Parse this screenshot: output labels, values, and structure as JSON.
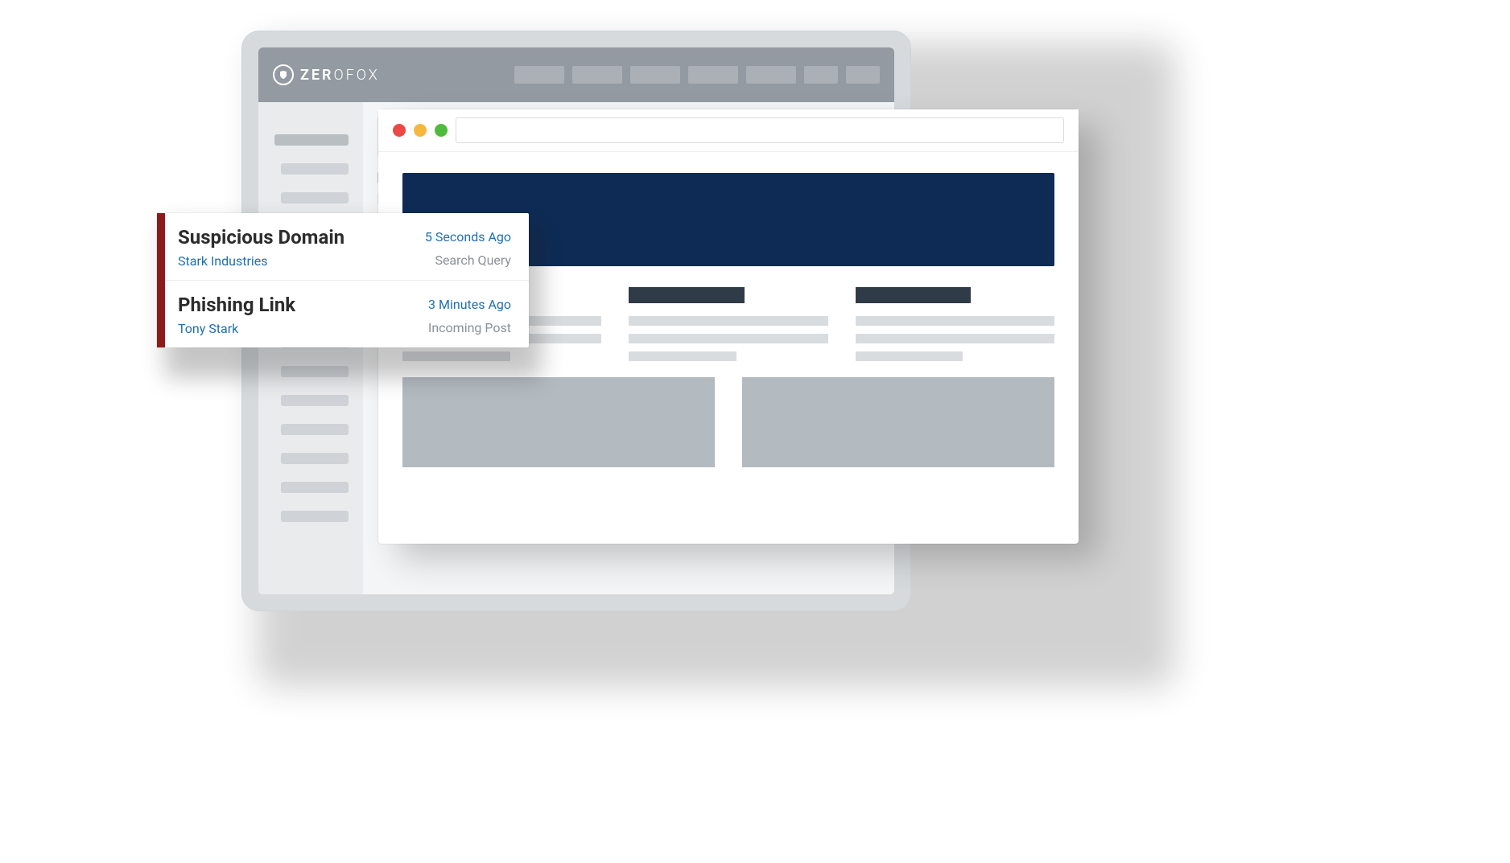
{
  "brand": {
    "name_bold": "ZER",
    "name_thin": "OFOX"
  },
  "alerts": {
    "items": [
      {
        "title": "Suspicious Domain",
        "subtitle": "Stark Industries",
        "time": "5 Seconds Ago",
        "type": "Search Query"
      },
      {
        "title": "Phishing Link",
        "subtitle": "Tony Stark",
        "time": "3 Minutes Ago",
        "type": "Incoming Post"
      }
    ]
  },
  "colors": {
    "accent_red": "#8e1b1b",
    "hero_blue": "#0d2b55",
    "link_blue": "#1f6fb2"
  }
}
